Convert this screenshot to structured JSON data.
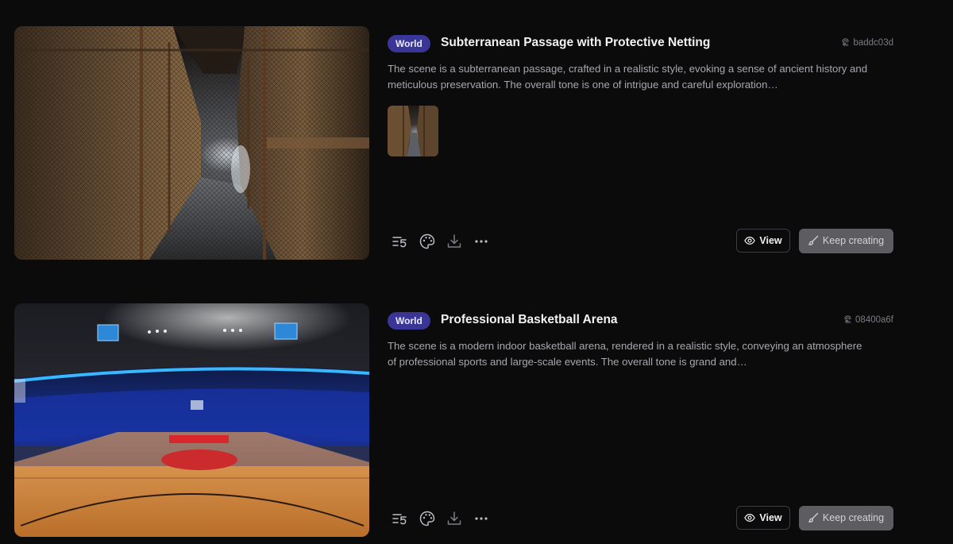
{
  "colors": {
    "background": "#0b0b0c",
    "badge": "#3a3698",
    "primary_button": "#5d5d61"
  },
  "cards": [
    {
      "badge": "World",
      "title": "Subterranean Passage with Protective Netting",
      "hash": "baddc03d",
      "hash_icon": "fingerprint-icon",
      "description": "The scene is a subterranean passage, crafted in a realistic style, evoking a sense of ancient history and meticulous preservation. The overall tone is one of intrigue and careful exploration…",
      "has_thumbnail": true,
      "tools": [
        "prompt-history-icon",
        "palette-icon",
        "download-icon",
        "more-icon"
      ],
      "view_label": "View",
      "keep_label": "Keep creating"
    },
    {
      "badge": "World",
      "title": "Professional Basketball Arena",
      "hash": "08400a6f",
      "hash_icon": "fingerprint-icon",
      "description": "The scene is a modern indoor basketball arena, rendered in a realistic style, conveying an atmosphere of professional sports and large-scale events. The overall tone is grand and…",
      "has_thumbnail": false,
      "tools": [
        "prompt-history-icon",
        "palette-icon",
        "download-icon",
        "more-icon"
      ],
      "view_label": "View",
      "keep_label": "Keep creating"
    }
  ]
}
